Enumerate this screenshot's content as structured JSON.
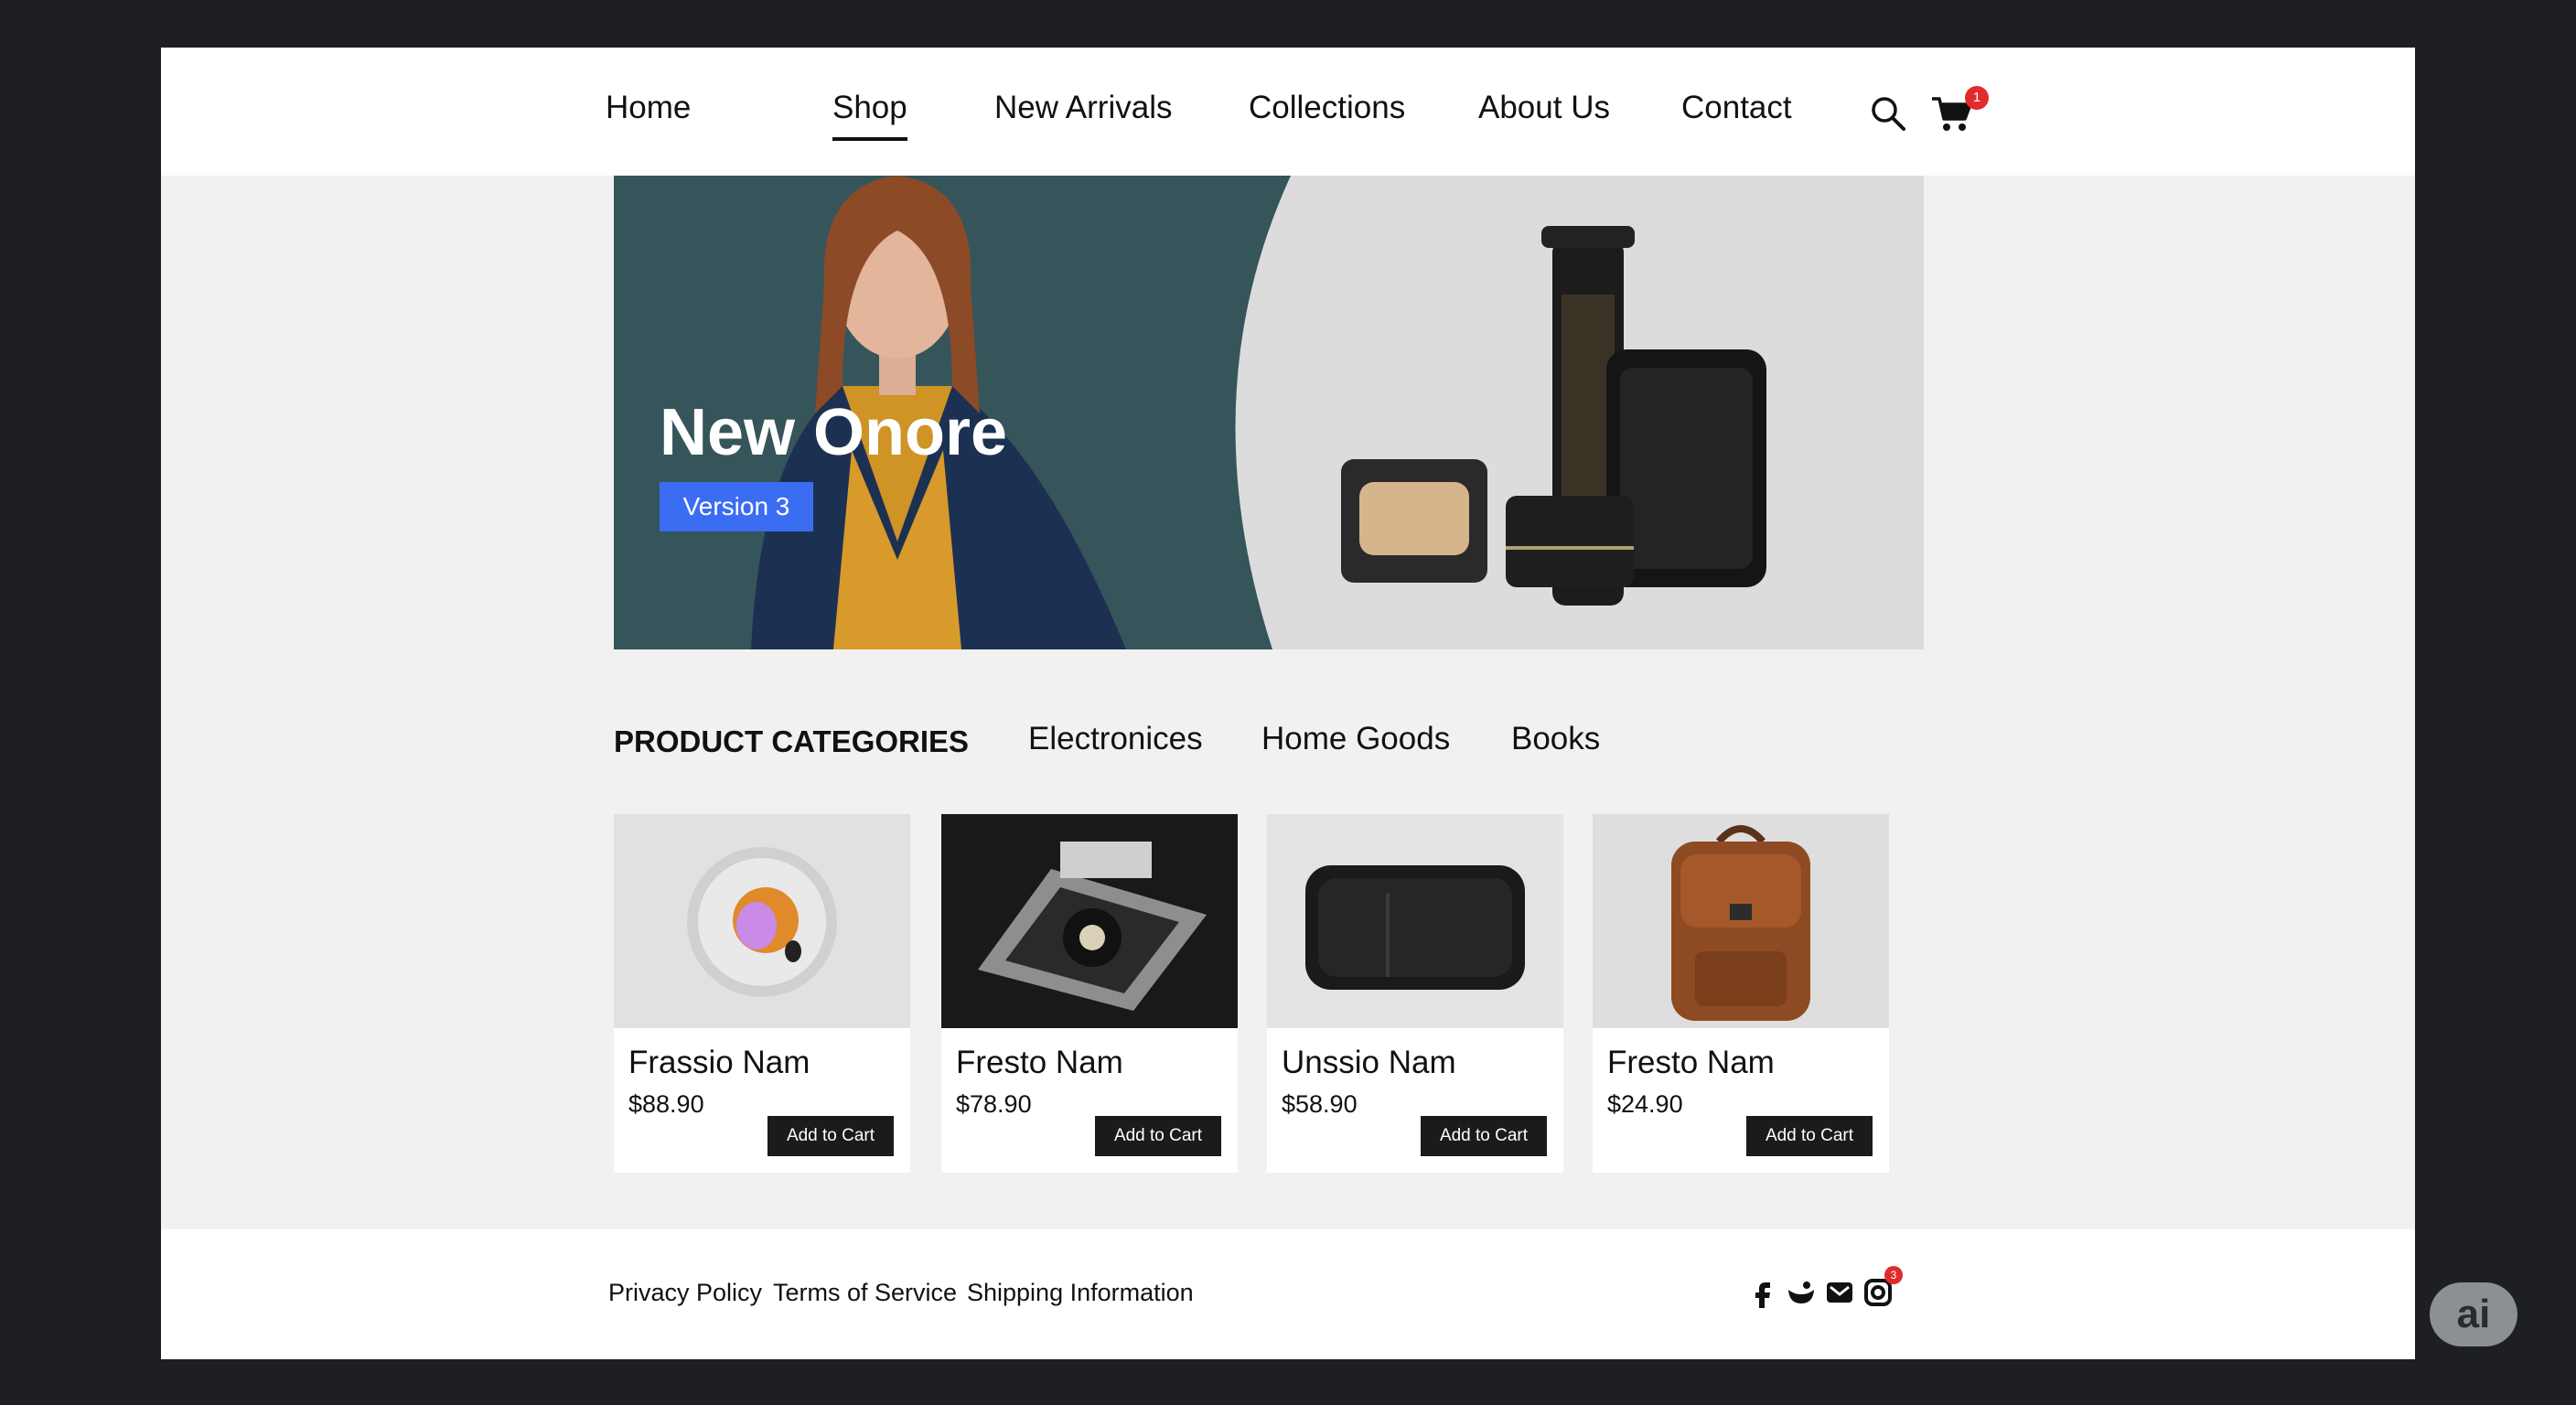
{
  "nav": {
    "items": [
      "Home",
      "Shop",
      "New Arrivals",
      "Collections",
      "About Us",
      "Contact"
    ],
    "active": "Shop",
    "cart_count": "1",
    "icons": [
      "search-icon",
      "cart-icon"
    ]
  },
  "hero": {
    "title": "New Onore",
    "badge": "Version 3"
  },
  "categories": {
    "heading": "PRODUCT CATEGORIES",
    "items": [
      "Electronices",
      "Home Goods",
      "Books"
    ]
  },
  "products": [
    {
      "name": "Frassio Nam",
      "price": "$88.90",
      "button": "Add to Cart"
    },
    {
      "name": "Fresto Nam",
      "price": "$78.90",
      "button": "Add to Cart"
    },
    {
      "name": "Unssio Nam",
      "price": "$58.90",
      "button": "Add to Cart"
    },
    {
      "name": "Fresto Nam",
      "price": "$24.90",
      "button": "Add to Cart"
    }
  ],
  "footer": {
    "links": [
      "Privacy Policy",
      "Terms of Service",
      "Shipping Information"
    ],
    "social_icons": [
      "facebook-icon",
      "bird-icon",
      "mail-icon",
      "instagram-icon"
    ],
    "social_badge": "3"
  },
  "assistant": {
    "label": "ai"
  },
  "colors": {
    "accent": "#3b6df2",
    "badge": "#e22b2b",
    "button": "#1b1b1b",
    "hero_teal": "#35545a",
    "outer_bg": "#1d1f24"
  }
}
